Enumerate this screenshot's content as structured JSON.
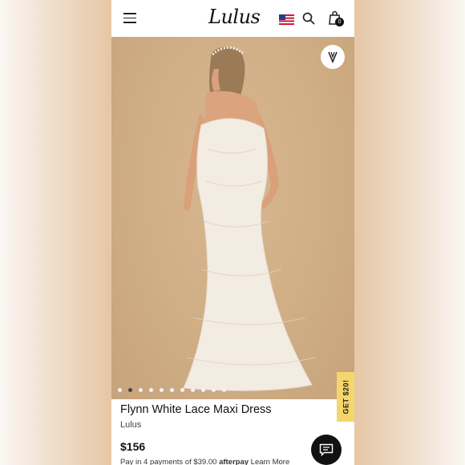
{
  "header": {
    "logo_text": "Lulus",
    "cart_count": "0",
    "icons": [
      "hamburger-menu-icon",
      "us-flag-icon",
      "search-icon",
      "shopping-bag-icon"
    ]
  },
  "hero": {
    "description": "Model in white lace maxi dress, back view",
    "carousel_total": 11,
    "carousel_active": 1,
    "get_tab_label": "GET $20!"
  },
  "product": {
    "title": "Flynn White Lace Maxi Dress",
    "brand": "Lulus",
    "price": "$156",
    "installments_prefix": "Pay in 4 payments of $39.00",
    "installments_provider": "afterpay",
    "installments_link": "Learn More"
  },
  "colors": {
    "accent_yellow": "#f5d66b",
    "text_dark": "#111111"
  }
}
